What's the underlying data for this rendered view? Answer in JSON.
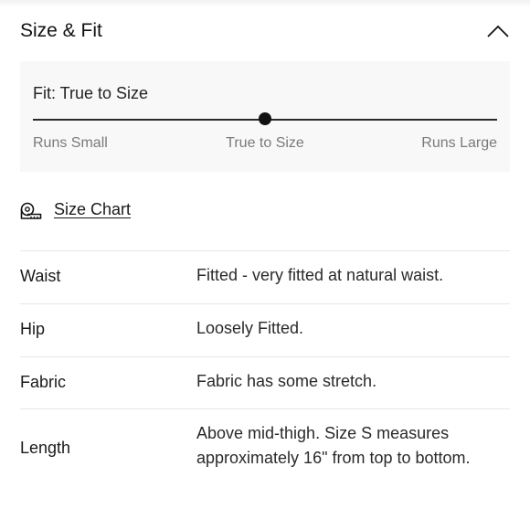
{
  "section": {
    "title": "Size & Fit",
    "toggle_icon": "chevron-up-icon"
  },
  "fit": {
    "label": "Fit: True to Size",
    "scale": {
      "left": "Runs Small",
      "middle": "True to Size",
      "right": "Runs Large"
    },
    "position": 0.5
  },
  "size_chart": {
    "label": "Size Chart",
    "icon": "measuring-tape-icon"
  },
  "details": [
    {
      "label": "Waist",
      "value": "Fitted - very fitted at natural waist."
    },
    {
      "label": "Hip",
      "value": "Loosely Fitted."
    },
    {
      "label": "Fabric",
      "value": "Fabric has some stretch."
    },
    {
      "label": "Length",
      "value": "Above mid-thigh. Size S measures approximately 16\" from top to bottom."
    }
  ]
}
